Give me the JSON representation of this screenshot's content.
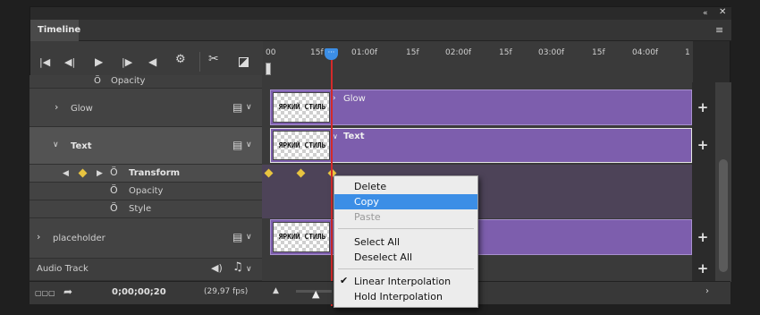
{
  "panel": {
    "tab_label": "Timeline"
  },
  "controls": {
    "timecode": "0;00;00;20",
    "fps": "(29,97 fps)"
  },
  "ruler": {
    "ticks": [
      "00",
      "15f",
      "01:00f",
      "15f",
      "02:00f",
      "15f",
      "03:00f",
      "15f",
      "04:00f",
      "1"
    ]
  },
  "layers": {
    "opacity_top": "Opacity",
    "glow": "Glow",
    "text": "Text",
    "transform": "Transform",
    "opacity": "Opacity",
    "style": "Style",
    "placeholder": "placeholder",
    "audio": "Audio Track"
  },
  "clips": {
    "glow_label": "Glow",
    "text_label": "Text",
    "thumb_text": "ЯРКИЙ СТИЛЬ"
  },
  "context_menu": {
    "items": [
      {
        "label": "Delete",
        "state": "normal"
      },
      {
        "label": "Copy",
        "state": "highlighted"
      },
      {
        "label": "Paste",
        "state": "disabled"
      },
      {
        "label": "Select All",
        "state": "normal"
      },
      {
        "label": "Deselect All",
        "state": "normal"
      },
      {
        "label": "Linear Interpolation",
        "state": "checked"
      },
      {
        "label": "Hold Interpolation",
        "state": "normal"
      }
    ]
  },
  "colors": {
    "clip": "#7d5ead",
    "playhead": "#d42a2a",
    "highlight": "#3c8ee6",
    "keyframe": "#e8c440"
  }
}
